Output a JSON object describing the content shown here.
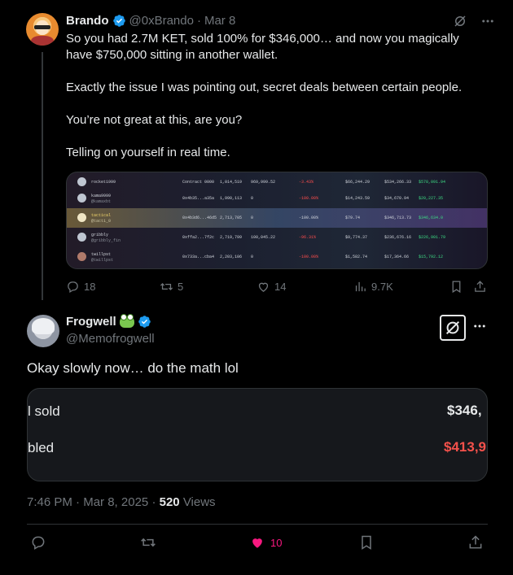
{
  "parent_tweet": {
    "name": "Brando",
    "handle": "@0xBrando",
    "dot": "·",
    "date": "Mar 8",
    "paragraphs": [
      "So you had 2.7M KET, sold 100% for $346,000… and now you magically have $750,000 sitting in another wallet.",
      "Exactly the issue I was pointing out, secret deals between certain people.",
      "You’re not great at this, are you?",
      "Telling on yourself in real time."
    ],
    "media_rows": [
      {
        "name": "rocket1999",
        "addr": "Contract 0000",
        "amt": "1,014,519",
        "b": "969,999.52",
        "pct": "-3.43%",
        "v1": "$66,244.29",
        "v2": "$534,266.33",
        "v3": "$578,091.94"
      },
      {
        "name": "kama9999",
        "sub": "@kamaxbt",
        "addr": "0x4b35...a35a",
        "amt": "1,990,113",
        "b": "0",
        "pct": "-100.00%",
        "v1": "$14,243.59",
        "v2": "$34,670.94",
        "v3": "$20,227.35"
      },
      {
        "name": "tactical",
        "sub": "@tacti_0",
        "addr": "0x4b3d6...46d5",
        "amt": "2,713,705",
        "b": "0",
        "pct": "-100.00%",
        "v1": "$79.74",
        "v2": "$346,713.73",
        "v3": "$346,634.0"
      },
      {
        "name": "gribbly",
        "sub": "@gribbly_fin",
        "addr": "0xffa2...7f2c",
        "amt": "2,719,799",
        "b": "100,045.22",
        "pct": "-96.31%",
        "v1": "$9,774.37",
        "v2": "$236,676.16",
        "v3": "$226,901.79"
      },
      {
        "name": "twillpst",
        "sub": "@twillpst",
        "addr": "0x733a...cba4",
        "amt": "2,203,106",
        "b": "0",
        "pct": "-100.00%",
        "v1": "$1,582.74",
        "v2": "$17,364.66",
        "v3": "$15,792.12"
      }
    ],
    "stats": {
      "replies": "18",
      "reposts": "5",
      "likes": "14",
      "views": "9.7K"
    }
  },
  "main_tweet": {
    "name": "Frogwell",
    "handle": "@Memofrogwell",
    "text": "Okay slowly now… do the math lol",
    "card": {
      "row1_label": "l sold",
      "row1_value": "$346,",
      "row2_label": "bled",
      "row2_value": "$413,9"
    },
    "time": "7:46 PM",
    "dot": "·",
    "date": "Mar 8, 2025",
    "views_count": "520",
    "views_label": "Views",
    "likes": "10"
  },
  "colors": {
    "verified": "#1d9bf0",
    "like": "#f91880",
    "negative_value": "#f4514b",
    "muted": "#71767b"
  }
}
